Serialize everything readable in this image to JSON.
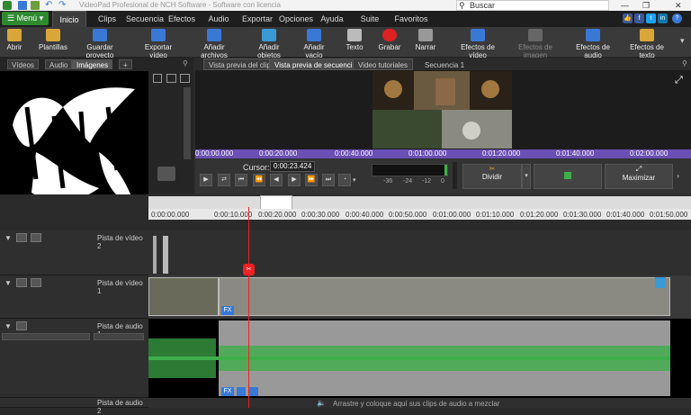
{
  "window": {
    "title": "VideoPad Profesional de NCH Software - Software con licencia",
    "search_placeholder": "Buscar"
  },
  "menubar": {
    "menu_button": "Menú",
    "tabs": [
      "Inicio",
      "Clips",
      "Secuencia",
      "Efectos",
      "Audio",
      "Exportar",
      "Opciones",
      "Ayuda",
      "Suite NCH",
      "Favoritos"
    ],
    "active_tab": "Inicio"
  },
  "toolbar": {
    "buttons": [
      {
        "label": "Abrir",
        "icon": "folder-open-icon"
      },
      {
        "label": "Plantillas",
        "icon": "templates-icon"
      },
      {
        "label": "Guardar proyecto",
        "icon": "save-icon"
      },
      {
        "label": "Exportar vídeo",
        "icon": "export-video-icon"
      },
      {
        "label": "Añadir archivos",
        "icon": "add-files-icon"
      },
      {
        "label": "Añadir objetos",
        "icon": "add-objects-icon"
      },
      {
        "label": "Añadir vacío",
        "icon": "add-blank-icon"
      },
      {
        "label": "Texto",
        "icon": "text-icon"
      },
      {
        "label": "Grabar",
        "icon": "record-icon"
      },
      {
        "label": "Narrar",
        "icon": "microphone-icon"
      },
      {
        "label": "Efectos de vídeo",
        "icon": "video-effects-icon"
      },
      {
        "label": "Efectos de imagen",
        "icon": "image-effects-icon"
      },
      {
        "label": "Efectos de audio",
        "icon": "audio-effects-icon"
      },
      {
        "label": "Efectos de texto",
        "icon": "text-effects-icon"
      }
    ]
  },
  "media_bin": {
    "tabs": [
      "Vídeos",
      "Audio",
      "Imágenes",
      "+"
    ],
    "active_tab": "Imágenes"
  },
  "preview": {
    "tabs": [
      "Vista previa del clip",
      "Vista previa de secuencia",
      "Video tutoriales",
      "Secuencia 1"
    ],
    "active_tab": "Vista previa de secuencia",
    "ruler_ticks": [
      "0:00:00.000",
      "0:00:20.000",
      "0:00:40.000",
      "0:01:00.000",
      "0:01:20.000",
      "0:01:40.000",
      "0:02:00.000"
    ],
    "cursor_label": "Cursor:",
    "cursor_value": "0:00:23.424",
    "level_ticks": [
      "-36",
      "-24",
      "-12",
      "0"
    ],
    "split_label": "Dividir",
    "maximize_label": "Maximizar"
  },
  "timeline": {
    "ruler_ticks": [
      "0:00:00.000",
      "0:00:10.000",
      "0:00:20.000",
      "0:00:30.000",
      "0:00:40.000",
      "0:00:50.000",
      "0:01:00.000",
      "0:01:10.000",
      "0:01:20.000",
      "0:01:30.000",
      "0:01:40.000",
      "0:01:50.000"
    ],
    "tracks": [
      {
        "name": "Pista de vídeo 2"
      },
      {
        "name": "Pista de vídeo 1"
      },
      {
        "name": "Pista de audio 1"
      },
      {
        "name": "Pista de audio 2"
      }
    ],
    "audio_drop_hint": "Arrastre y coloque aquí sus clips de audio a mezclar",
    "fx_label": "FX"
  },
  "colors": {
    "accent_green": "#2f8a2f",
    "sequence_ruler": "#6a4fb5",
    "playhead": "#e22222",
    "waveform": "#3fae4a"
  }
}
